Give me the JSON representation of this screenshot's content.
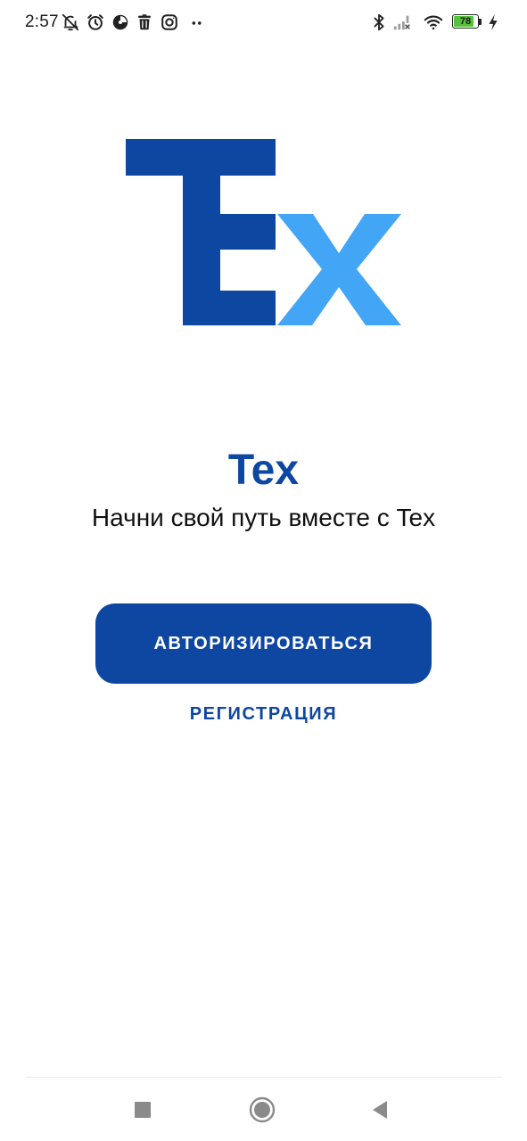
{
  "status_bar": {
    "time": "2:57",
    "battery_level": "78",
    "battery_fraction": 0.78,
    "icons": [
      "bell-off-icon",
      "alarm-icon",
      "pie-chart-icon",
      "trash-icon",
      "instagram-icon",
      "more-dots-icon",
      "bluetooth-icon",
      "signal-icon",
      "wifi-icon",
      "battery-icon",
      "charging-icon"
    ]
  },
  "logo": {
    "icon": "tex-logo-icon",
    "colors": {
      "dark_blue": "#0d47a1",
      "light_blue": "#42a5f5"
    }
  },
  "welcome": {
    "title": "Tex",
    "tagline": "Начни свой путь вместе с Tex"
  },
  "actions": {
    "login_label": "АВТОРИЗИРОВАТЬСЯ",
    "register_label": "РЕГИСТРАЦИЯ"
  },
  "navigation_bar": {
    "icons": [
      "recents-square-icon",
      "home-circle-icon",
      "back-triangle-icon"
    ]
  },
  "colors": {
    "primary": "#0d47a1",
    "accent": "#42a5f5",
    "background": "#ffffff",
    "battery_fill": "#56c13a"
  }
}
